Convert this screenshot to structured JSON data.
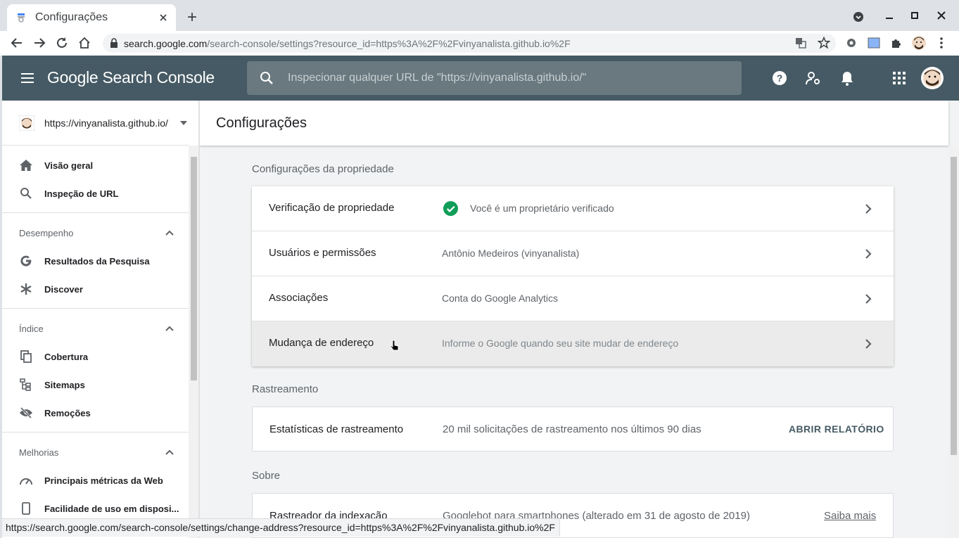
{
  "browser": {
    "tab_title": "Configurações",
    "new_tab_label": "+",
    "url_host": "search.google.com",
    "url_path": "/search-console/settings?resource_id=https%3A%2F%2Fvinyanalista.github.io%2F"
  },
  "app": {
    "logo_text": "Google Search Console",
    "search_placeholder": "Inspecionar qualquer URL de \"https://vinyanalista.github.io/\""
  },
  "sidebar": {
    "property": "https://vinyanalista.github.io/",
    "top_items": [
      {
        "label": "Visão geral",
        "icon": "home-icon"
      },
      {
        "label": "Inspeção de URL",
        "icon": "search-icon"
      }
    ],
    "sections": [
      {
        "title": "Desempenho",
        "items": [
          {
            "label": "Resultados da Pesquisa",
            "icon": "google-g-icon"
          },
          {
            "label": "Discover",
            "icon": "asterisk-icon"
          }
        ]
      },
      {
        "title": "Índice",
        "items": [
          {
            "label": "Cobertura",
            "icon": "copy-icon"
          },
          {
            "label": "Sitemaps",
            "icon": "sitemap-icon"
          },
          {
            "label": "Remoções",
            "icon": "visibility-off-icon"
          }
        ]
      },
      {
        "title": "Melhorias",
        "items": [
          {
            "label": "Principais métricas da Web",
            "icon": "speed-icon"
          },
          {
            "label": "Facilidade de uso em disposi...",
            "icon": "phone-icon"
          }
        ]
      }
    ]
  },
  "main": {
    "page_title": "Configurações",
    "property_section": {
      "title": "Configurações da propriedade",
      "rows": [
        {
          "label": "Verificação de propriedade",
          "value": "Você é um proprietário verificado",
          "verified": true
        },
        {
          "label": "Usuários e permissões",
          "value": "Antônio Medeiros (vinyanalista)"
        },
        {
          "label": "Associações",
          "value": "Conta do Google Analytics"
        },
        {
          "label": "Mudança de endereço",
          "value": "Informe o Google quando seu site mudar de endereço"
        }
      ]
    },
    "crawl_section": {
      "title": "Rastreamento",
      "label": "Estatísticas de rastreamento",
      "value": "20 mil solicitações de rastreamento nos últimos 90 dias",
      "action": "ABRIR RELATÓRIO"
    },
    "about_section": {
      "title": "Sobre",
      "label": "Rastreador da indexação",
      "value": "Googlebot para smartphones (alterado em 31 de agosto de 2019)",
      "action": "Saiba mais"
    }
  },
  "status_url": "https://search.google.com/search-console/settings/change-address?resource_id=https%3A%2F%2Fvinyanalista.github.io%2F",
  "colors": {
    "header": "#455a64",
    "verified_green": "#0f9d58",
    "hover_row": "#ebebeb"
  }
}
